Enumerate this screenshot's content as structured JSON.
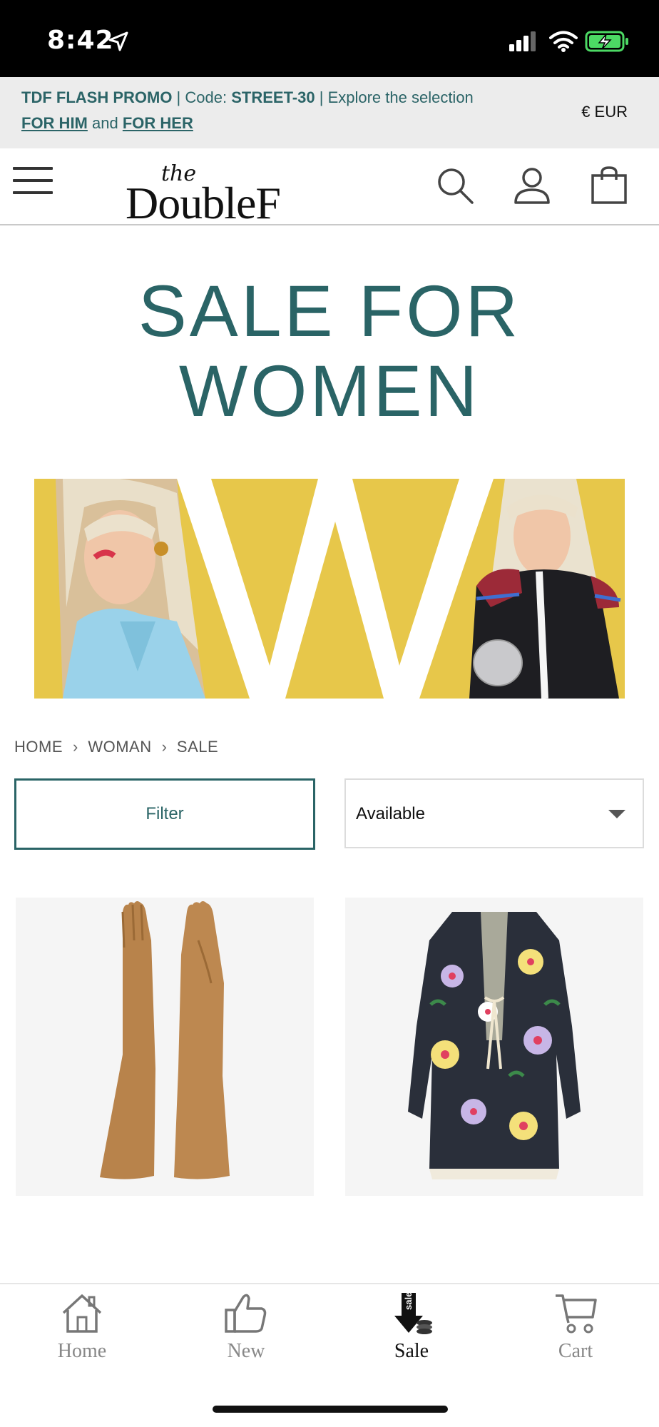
{
  "status_bar": {
    "time": "8:42",
    "icons": [
      "location-arrow-icon",
      "cellular-signal-icon",
      "wifi-icon",
      "battery-charging-icon"
    ]
  },
  "promo": {
    "title": "TDF FLASH PROMO",
    "code_label": "Code:",
    "code": "STREET-30",
    "explore": "Explore the selection",
    "for_him": "FOR HIM",
    "and": "and",
    "for_her": "FOR HER",
    "currency": "€ EUR"
  },
  "header": {
    "logo_the": "the",
    "logo_main": "DoubleF",
    "icons": [
      "menu-icon",
      "search-icon",
      "account-icon",
      "shopping-bag-icon"
    ]
  },
  "page": {
    "title_line1": "SALE FOR",
    "title_line2": "WOMEN"
  },
  "breadcrumb": [
    "HOME",
    "WOMAN",
    "SALE"
  ],
  "controls": {
    "filter_label": "Filter",
    "sort_value": "Available"
  },
  "tabbar": {
    "tabs": [
      {
        "label": "Home",
        "icon": "home-icon"
      },
      {
        "label": "New",
        "icon": "thumbs-up-icon"
      },
      {
        "label": "Sale",
        "icon": "sale-icon",
        "badge": "sale",
        "active": true
      },
      {
        "label": "Cart",
        "icon": "cart-icon"
      }
    ]
  },
  "colors": {
    "brand_teal": "#2a6466",
    "hero_yellow": "#e7c74a",
    "promo_bg": "#ececec"
  }
}
